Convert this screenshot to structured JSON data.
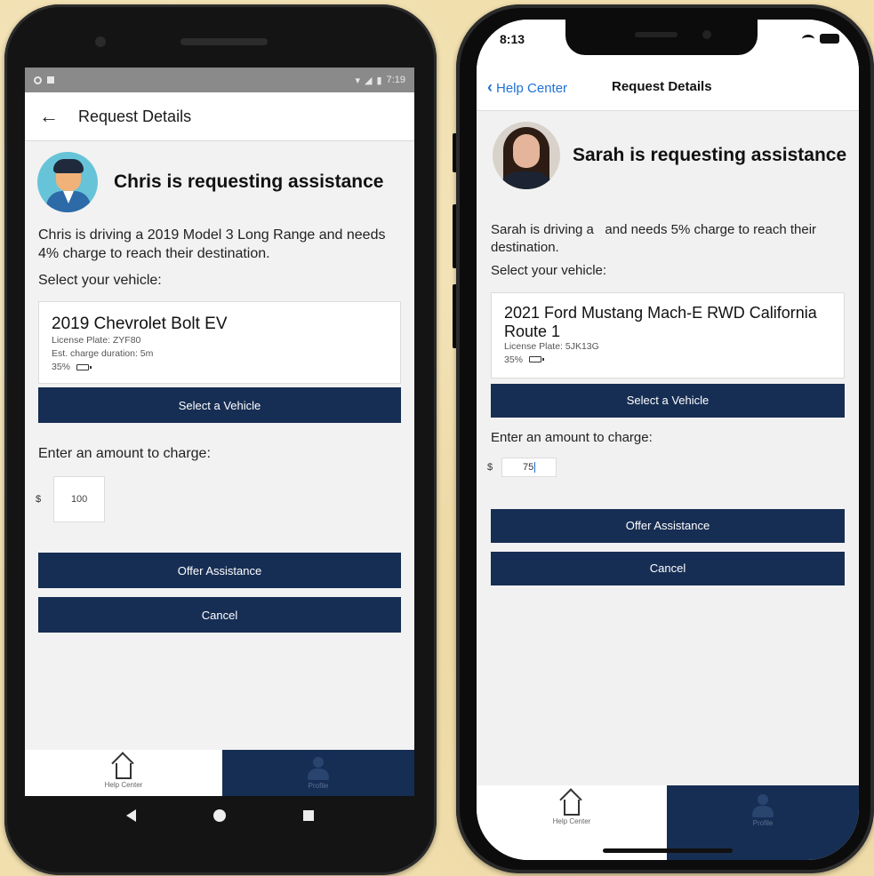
{
  "android": {
    "status": {
      "time": "7:19"
    },
    "appbar": {
      "back_icon": "arrow-left-icon",
      "title": "Request Details"
    },
    "requester": {
      "avatar": "avatar-male-icon",
      "headline": "Chris is requesting assistance"
    },
    "description": "Chris is driving a 2019 Model 3 Long Range and needs 4% charge to reach their destination.",
    "select_label": "Select your vehicle:",
    "vehicle": {
      "name": "2019 Chevrolet Bolt EV",
      "license": "License Plate: ZYF80",
      "duration": "Est. charge duration: 5m",
      "battery": "35%"
    },
    "select_button": "Select a Vehicle",
    "amount_label": "Enter an amount to charge:",
    "currency": "$",
    "amount_value": "100",
    "offer_button": "Offer Assistance",
    "cancel_button": "Cancel",
    "tabs": {
      "home": "Help Center",
      "profile": "Profile"
    }
  },
  "iphone": {
    "status": {
      "time": "8:13"
    },
    "nav": {
      "back": "Help Center",
      "title": "Request Details"
    },
    "requester": {
      "avatar": "avatar-photo",
      "headline": "Sarah is requesting assistance"
    },
    "description": "Sarah is driving a   and needs 5% charge to reach their destination.",
    "select_label": "Select your vehicle:",
    "vehicle": {
      "name": "2021 Ford Mustang Mach-E RWD California Route 1",
      "license": "License Plate: 5JK13G",
      "battery": "35%"
    },
    "select_button": "Select a Vehicle",
    "amount_label": "Enter an amount to charge:",
    "currency": "$",
    "amount_value": "75",
    "offer_button": "Offer Assistance",
    "cancel_button": "Cancel",
    "tabs": {
      "home": "Help Center",
      "profile": "Profile"
    }
  },
  "colors": {
    "primary": "#172e54",
    "link": "#1e72d6",
    "background": "#f1dfae"
  }
}
